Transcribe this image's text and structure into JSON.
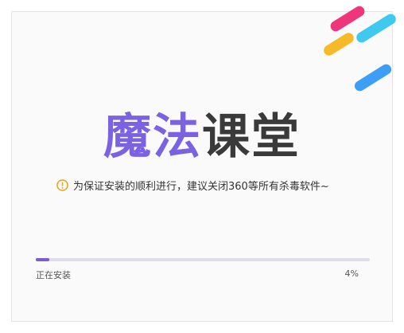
{
  "brand": {
    "logo_part1": "魔法",
    "logo_part2": "课堂",
    "part1_color": "#7b62e3",
    "part2_color": "#3a3a3a"
  },
  "decor": {
    "stripe_colors": [
      "#f0367a",
      "#3fc9ef",
      "#f6b928",
      "#3c9ef5"
    ]
  },
  "notice": {
    "icon": "warning-circle-icon",
    "icon_color": "#e8a317",
    "text": "为保证安装的顺利进行，建议关闭360等所有杀毒软件~"
  },
  "install": {
    "status": "正在安装",
    "percent_label": "4%",
    "progress": 0.04
  }
}
